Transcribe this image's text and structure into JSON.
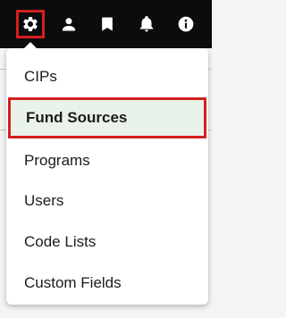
{
  "toolbar": {
    "icons": [
      {
        "name": "settings-gear-icon",
        "label": "Settings",
        "highlighted": true
      },
      {
        "name": "user-icon",
        "label": "Profile"
      },
      {
        "name": "bookmark-icon",
        "label": "Bookmarks"
      },
      {
        "name": "bell-icon",
        "label": "Notifications"
      },
      {
        "name": "info-icon",
        "label": "Information"
      }
    ],
    "icon_color": "#ffffff",
    "background": "#0b0c0c"
  },
  "settings_menu": {
    "items": [
      {
        "label": "CIPs"
      },
      {
        "label": "Fund Sources",
        "active": true
      },
      {
        "label": "Programs"
      },
      {
        "label": "Users"
      },
      {
        "label": "Code Lists"
      },
      {
        "label": "Custom Fields"
      }
    ],
    "highlight_color": "#d41f1f",
    "active_background": "#eaf3ea"
  }
}
